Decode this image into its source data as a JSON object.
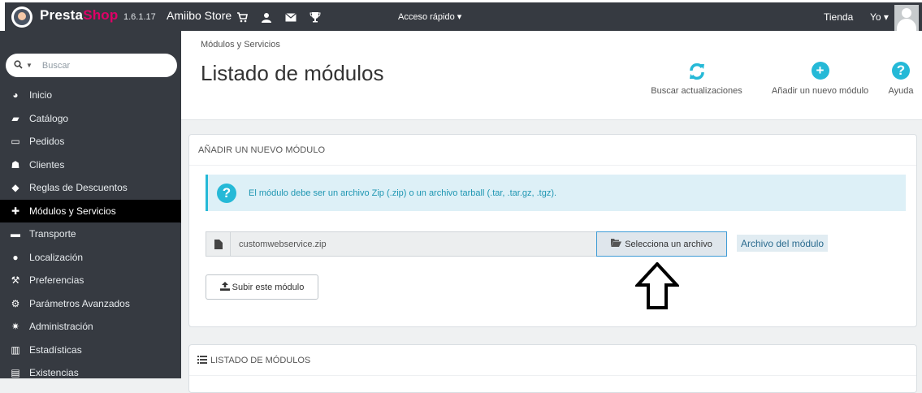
{
  "topbar": {
    "brand_part1": "Presta",
    "brand_part2": "Shop",
    "version": "1.6.1.17",
    "store_name": "Amiibo Store",
    "quick_access": "Acceso rápido",
    "shop_link": "Tienda",
    "user_menu": "Yo",
    "icons": [
      "cart-icon",
      "user-icon",
      "envelope-icon",
      "trophy-icon"
    ]
  },
  "sidebar": {
    "search_placeholder": "Buscar",
    "items": [
      {
        "icon": "dashboard-icon",
        "label": "Inicio"
      },
      {
        "icon": "book-icon",
        "label": "Catálogo"
      },
      {
        "icon": "credit-card-icon",
        "label": "Pedidos"
      },
      {
        "icon": "users-icon",
        "label": "Clientes"
      },
      {
        "icon": "tag-icon",
        "label": "Reglas de Descuentos"
      },
      {
        "icon": "puzzle-icon",
        "label": "Módulos y Servicios"
      },
      {
        "icon": "truck-icon",
        "label": "Transporte"
      },
      {
        "icon": "globe-icon",
        "label": "Localización"
      },
      {
        "icon": "wrench-icon",
        "label": "Preferencias"
      },
      {
        "icon": "cogs-icon",
        "label": "Parámetros Avanzados"
      },
      {
        "icon": "cog-icon",
        "label": "Administración"
      },
      {
        "icon": "bar-chart-icon",
        "label": "Estadísticas"
      },
      {
        "icon": "archive-icon",
        "label": "Existencias"
      }
    ]
  },
  "page": {
    "breadcrumb": "Módulos y Servicios",
    "title": "Listado de módulos",
    "toolbar": {
      "check_updates": "Buscar actualizaciones",
      "add_module": "Añadir un nuevo módulo",
      "help": "Ayuda"
    }
  },
  "add_panel": {
    "heading": "AÑADIR UN NUEVO MÓDULO",
    "alert_text": "El módulo debe ser un archivo Zip (.zip) o un archivo tarball (.tar, .tar.gz, .tgz).",
    "file_name": "customwebservice.zip",
    "select_button": "Selecciona un archivo",
    "file_label": "Archivo del módulo",
    "upload_button": "Subir este módulo"
  },
  "list_panel": {
    "heading": "LISTADO DE MÓDULOS"
  },
  "colors": {
    "topbar": "#363a41",
    "brand_accent": "#df0067",
    "primary": "#25b9d7",
    "active_nav": "#000000"
  }
}
